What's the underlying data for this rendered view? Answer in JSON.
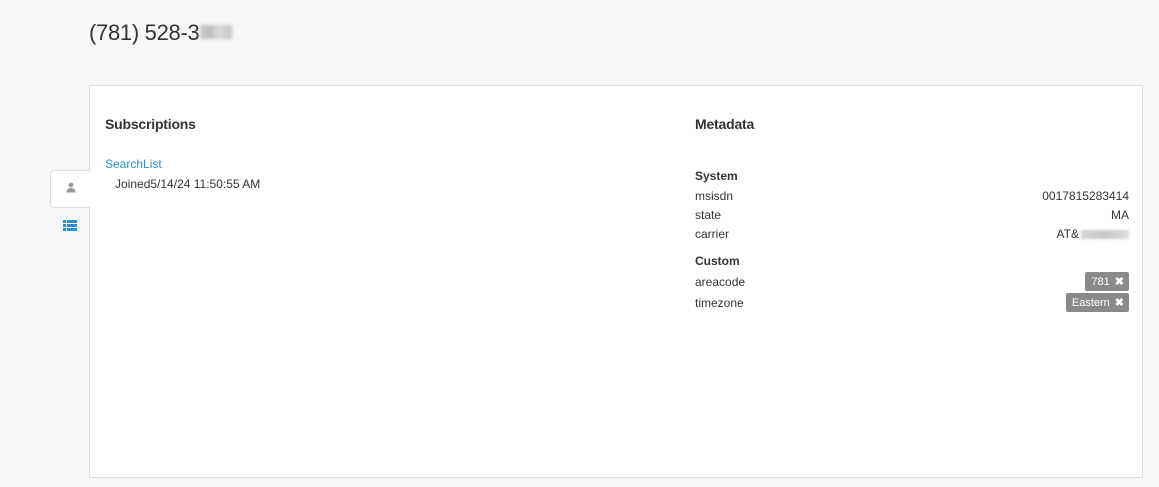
{
  "header": {
    "title": "(781) 528-3"
  },
  "tabs": [
    {
      "icon": "user-icon",
      "active": true
    },
    {
      "icon": "list-icon",
      "active": false
    }
  ],
  "subscriptions": {
    "title": "Subscriptions",
    "items": [
      {
        "name": "SearchList",
        "joined_label": "Joined",
        "joined_at": "5/14/24 11:50:55 AM"
      }
    ]
  },
  "metadata": {
    "title": "Metadata",
    "system": {
      "label": "System",
      "rows": [
        {
          "key": "msisdn",
          "value": "0017815283414"
        },
        {
          "key": "state",
          "value": "MA"
        },
        {
          "key": "carrier",
          "value": "AT&"
        }
      ]
    },
    "custom": {
      "label": "Custom",
      "rows": [
        {
          "key": "areacode",
          "value": "781"
        },
        {
          "key": "timezone",
          "value": "Eastern"
        }
      ]
    }
  },
  "colors": {
    "link": "#2a8fd4",
    "chip": "#8a8a8a",
    "icon_active": "#999999",
    "icon_list": "#2a8fd4"
  }
}
